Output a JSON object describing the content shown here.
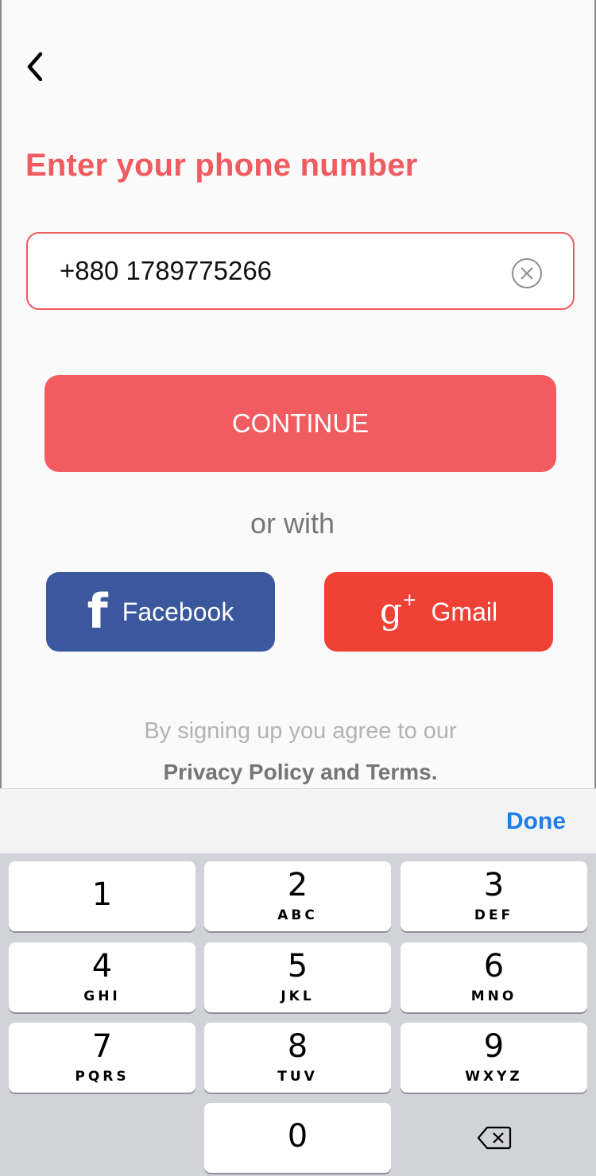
{
  "header": {
    "back_icon": "chevron-left-icon"
  },
  "title": "Enter your phone number",
  "phone": {
    "value": "+880 1789775266",
    "clear_icon": "clear-circle-icon"
  },
  "continue_label": "CONTINUE",
  "or_with": "or with",
  "social": {
    "facebook": {
      "label": "Facebook",
      "icon": "facebook-icon",
      "color": "#3b579d"
    },
    "gmail": {
      "label": "Gmail",
      "icon": "google-plus-icon",
      "color": "#ef4135"
    }
  },
  "terms": {
    "line1": "By signing up you agree to our",
    "line2": "Privacy Policy and Terms."
  },
  "keyboard": {
    "done_label": "Done",
    "keys": [
      {
        "num": "1",
        "letters": ""
      },
      {
        "num": "2",
        "letters": "ABC"
      },
      {
        "num": "3",
        "letters": "DEF"
      },
      {
        "num": "4",
        "letters": "GHI"
      },
      {
        "num": "5",
        "letters": "JKL"
      },
      {
        "num": "6",
        "letters": "MNO"
      },
      {
        "num": "7",
        "letters": "PQRS"
      },
      {
        "num": "8",
        "letters": "TUV"
      },
      {
        "num": "9",
        "letters": "WXYZ"
      },
      {
        "num": "0",
        "letters": ""
      }
    ],
    "delete_icon": "backspace-icon"
  },
  "colors": {
    "accent": "#ef5b5f",
    "link": "#1d7ee8"
  }
}
